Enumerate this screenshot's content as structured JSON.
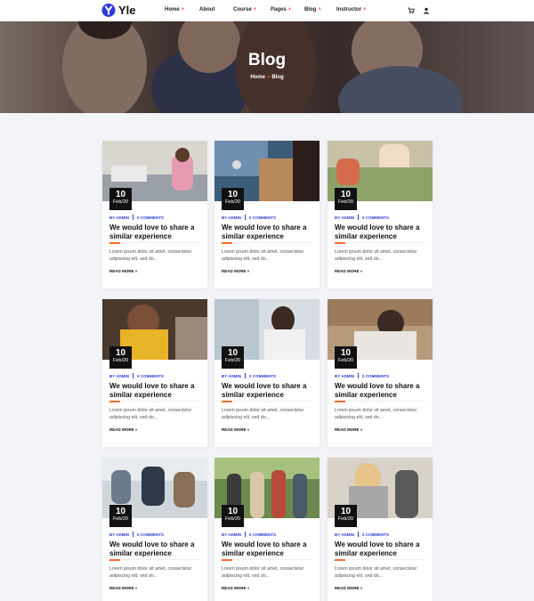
{
  "brand": {
    "name": "Yle",
    "accent": "#2b3cd9"
  },
  "nav": [
    {
      "label": "Home",
      "has_submenu": true
    },
    {
      "label": "About",
      "has_submenu": false
    },
    {
      "label": "Course",
      "has_submenu": true
    },
    {
      "label": "Pages",
      "has_submenu": true
    },
    {
      "label": "Blog",
      "has_submenu": true
    },
    {
      "label": "Instructor",
      "has_submenu": true
    }
  ],
  "header_icons": [
    "cart-icon",
    "user-icon"
  ],
  "hero": {
    "title": "Blog",
    "breadcrumb": {
      "home": "Home",
      "separator": "»",
      "current": "Blog"
    }
  },
  "posts": [
    {
      "day": "10",
      "month": "Feb/20",
      "author": "BY ADMIN",
      "comments": "0 COMMENTS",
      "title": "We would love to share a similar experience",
      "excerpt": "Lorem ipsum dolor sit amet, consectetur adipiscing elit, sed do...",
      "read_more": "READ MORE »"
    },
    {
      "day": "10",
      "month": "Feb/20",
      "author": "BY ADMIN",
      "comments": "0 COMMENTS",
      "title": "We would love to share a similar experience",
      "excerpt": "Lorem ipsum dolor sit amet, consectetur adipiscing elit, sed do...",
      "read_more": "READ MORE »"
    },
    {
      "day": "10",
      "month": "Feb/20",
      "author": "BY ADMIN",
      "comments": "0 COMMENTS",
      "title": "We would love to share a similar experience",
      "excerpt": "Lorem ipsum dolor sit amet, consectetur adipiscing elit, sed do...",
      "read_more": "READ MORE »"
    },
    {
      "day": "10",
      "month": "Feb/20",
      "author": "BY ADMIN",
      "comments": "0 COMMENTS",
      "title": "We would love to share a similar experience",
      "excerpt": "Lorem ipsum dolor sit amet, consectetur adipiscing elit, sed do...",
      "read_more": "READ MORE »"
    },
    {
      "day": "10",
      "month": "Feb/20",
      "author": "BY ADMIN",
      "comments": "0 COMMENTS",
      "title": "We would love to share a similar experience",
      "excerpt": "Lorem ipsum dolor sit amet, consectetur adipiscing elit, sed do...",
      "read_more": "READ MORE »"
    },
    {
      "day": "10",
      "month": "Feb/20",
      "author": "BY ADMIN",
      "comments": "0 COMMENTS",
      "title": "We would love to share a similar experience",
      "excerpt": "Lorem ipsum dolor sit amet, consectetur adipiscing elit, sed do...",
      "read_more": "READ MORE »"
    },
    {
      "day": "10",
      "month": "Feb/20",
      "author": "BY ADMIN",
      "comments": "0 COMMENTS",
      "title": "We would love to share a similar experience",
      "excerpt": "Lorem ipsum dolor sit amet, consectetur adipiscing elit, sed do...",
      "read_more": "READ MORE »"
    },
    {
      "day": "10",
      "month": "Feb/20",
      "author": "BY ADMIN",
      "comments": "0 COMMENTS",
      "title": "We would love to share a similar experience",
      "excerpt": "Lorem ipsum dolor sit amet, consectetur adipiscing elit, sed do...",
      "read_more": "READ MORE »"
    },
    {
      "day": "10",
      "month": "Feb/20",
      "author": "BY ADMIN",
      "comments": "0 COMMENTS",
      "title": "We would love to share a similar experience",
      "excerpt": "Lorem ipsum dolor sit amet, consectetur adipiscing elit, sed do...",
      "read_more": "READ MORE »"
    }
  ]
}
